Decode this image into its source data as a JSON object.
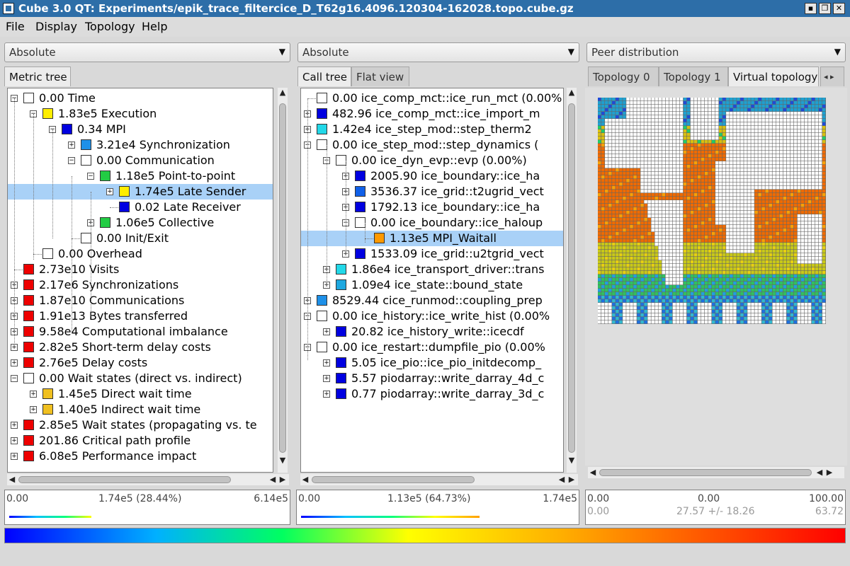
{
  "window": {
    "title": "Cube 3.0 QT: Experiments/epik_trace_filtercice_D_T62g16.4096.120304-162028.topo.cube.gz"
  },
  "menu": [
    "File",
    "Display",
    "Topology",
    "Help"
  ],
  "panels": {
    "metric": {
      "mode": "Absolute",
      "tabs": [
        "Metric tree"
      ]
    },
    "call": {
      "mode": "Absolute",
      "tabs": [
        "Call tree",
        "Flat view"
      ]
    },
    "system": {
      "mode": "Peer distribution",
      "tabs": [
        "Topology 0",
        "Topology 1",
        "Virtual topology"
      ]
    }
  },
  "metric_tree": [
    {
      "text": "0.00 Time",
      "color": "#ffffff",
      "depth": 0,
      "exp": "-"
    },
    {
      "text": "1.83e5 Execution",
      "color": "#ffee00",
      "depth": 1,
      "exp": "-"
    },
    {
      "text": "0.34 MPI",
      "color": "#0000e0",
      "depth": 2,
      "exp": "-"
    },
    {
      "text": "3.21e4 Synchronization",
      "color": "#1e90e8",
      "depth": 3,
      "exp": "+"
    },
    {
      "text": "0.00 Communication",
      "color": "#ffffff",
      "depth": 3,
      "exp": "-"
    },
    {
      "text": "1.18e5 Point-to-point",
      "color": "#22cc44",
      "depth": 4,
      "exp": "-"
    },
    {
      "text": "1.74e5 Late Sender",
      "color": "#ffee00",
      "depth": 5,
      "exp": "+",
      "selected": true
    },
    {
      "text": "0.02 Late Receiver",
      "color": "#0000e0",
      "depth": 5,
      "exp": ""
    },
    {
      "text": "1.06e5 Collective",
      "color": "#22cc44",
      "depth": 4,
      "exp": "+"
    },
    {
      "text": "0.00 Init/Exit",
      "color": "#ffffff",
      "depth": 3,
      "exp": ""
    },
    {
      "text": "0.00 Overhead",
      "color": "#ffffff",
      "depth": 1,
      "exp": ""
    },
    {
      "text": "2.73e10 Visits",
      "color": "#ee0000",
      "depth": 0,
      "exp": ""
    },
    {
      "text": "2.17e6 Synchronizations",
      "color": "#ee0000",
      "depth": 0,
      "exp": "+"
    },
    {
      "text": "1.87e10 Communications",
      "color": "#ee0000",
      "depth": 0,
      "exp": "+"
    },
    {
      "text": "1.91e13 Bytes transferred",
      "color": "#ee0000",
      "depth": 0,
      "exp": "+"
    },
    {
      "text": "9.58e4 Computational imbalance",
      "color": "#ee0000",
      "depth": 0,
      "exp": "+"
    },
    {
      "text": "2.82e5 Short-term delay costs",
      "color": "#ee0000",
      "depth": 0,
      "exp": "+"
    },
    {
      "text": "2.76e5 Delay costs",
      "color": "#ee0000",
      "depth": 0,
      "exp": "+"
    },
    {
      "text": "0.00 Wait states (direct vs. indirect)",
      "color": "#ffffff",
      "depth": 0,
      "exp": "-"
    },
    {
      "text": "1.45e5 Direct wait time",
      "color": "#f0c020",
      "depth": 1,
      "exp": "+"
    },
    {
      "text": "1.40e5 Indirect wait time",
      "color": "#f0c020",
      "depth": 1,
      "exp": "+"
    },
    {
      "text": "2.85e5 Wait states (propagating vs. te",
      "color": "#ee0000",
      "depth": 0,
      "exp": "+"
    },
    {
      "text": "201.86 Critical path profile",
      "color": "#ee0000",
      "depth": 0,
      "exp": "+"
    },
    {
      "text": "6.08e5 Performance impact",
      "color": "#ee0000",
      "depth": 0,
      "exp": "+"
    }
  ],
  "call_tree": [
    {
      "text": "0.00 ice_comp_mct::ice_run_mct (0.00%",
      "color": "#ffffff",
      "depth": 0,
      "exp": ""
    },
    {
      "text": "482.96 ice_comp_mct::ice_import_m",
      "color": "#0000e0",
      "depth": 0,
      "exp": "+"
    },
    {
      "text": "1.42e4 ice_step_mod::step_therm2",
      "color": "#22d8e8",
      "depth": 0,
      "exp": "+"
    },
    {
      "text": "0.00 ice_step_mod::step_dynamics (",
      "color": "#ffffff",
      "depth": 0,
      "exp": "-"
    },
    {
      "text": "0.00 ice_dyn_evp::evp (0.00%)",
      "color": "#ffffff",
      "depth": 1,
      "exp": "-"
    },
    {
      "text": "2005.90 ice_boundary::ice_ha",
      "color": "#0000e0",
      "depth": 2,
      "exp": "+"
    },
    {
      "text": "3536.37 ice_grid::t2ugrid_vect",
      "color": "#1060e8",
      "depth": 2,
      "exp": "+"
    },
    {
      "text": "1792.13 ice_boundary::ice_ha",
      "color": "#0000e0",
      "depth": 2,
      "exp": "+"
    },
    {
      "text": "0.00 ice_boundary::ice_haloup",
      "color": "#ffffff",
      "depth": 2,
      "exp": "-"
    },
    {
      "text": "1.13e5 MPI_Waitall",
      "color": "#ff9900",
      "depth": 3,
      "exp": "",
      "selected": true
    },
    {
      "text": "1533.09 ice_grid::u2tgrid_vect",
      "color": "#0000e0",
      "depth": 2,
      "exp": "+"
    },
    {
      "text": "1.86e4 ice_transport_driver::trans",
      "color": "#22d8e8",
      "depth": 1,
      "exp": "+"
    },
    {
      "text": "1.09e4 ice_state::bound_state",
      "color": "#1ea8e0",
      "depth": 1,
      "exp": "+"
    },
    {
      "text": "8529.44 cice_runmod::coupling_prep",
      "color": "#1e90e8",
      "depth": 0,
      "exp": "+"
    },
    {
      "text": "0.00 ice_history::ice_write_hist (0.00%",
      "color": "#ffffff",
      "depth": 0,
      "exp": "-"
    },
    {
      "text": "20.82 ice_history_write::icecdf",
      "color": "#0000e0",
      "depth": 1,
      "exp": "+"
    },
    {
      "text": "0.00 ice_restart::dumpfile_pio (0.00%",
      "color": "#ffffff",
      "depth": 0,
      "exp": "-"
    },
    {
      "text": "5.05 ice_pio::ice_pio_initdecomp_",
      "color": "#0000e0",
      "depth": 1,
      "exp": "+"
    },
    {
      "text": "5.57 piodarray::write_darray_4d_c",
      "color": "#0000e0",
      "depth": 1,
      "exp": "+"
    },
    {
      "text": "0.77 piodarray::write_darray_3d_c",
      "color": "#0000e0",
      "depth": 1,
      "exp": "+"
    }
  ],
  "info": {
    "metric": {
      "min": "0.00",
      "mid": "1.74e5 (28.44%)",
      "max": "6.14e5"
    },
    "call": {
      "min": "0.00",
      "mid": "1.13e5 (64.73%)",
      "max": "1.74e5"
    },
    "system": {
      "min": "0.00",
      "mid": "0.00",
      "max": "100.00",
      "min2": "0.00",
      "mid2": "27.57 +/- 18.26",
      "max2": "63.72"
    }
  },
  "colors": {
    "selection": "#a9d1f7",
    "titlebar": "#2d6ea8"
  },
  "icons": [
    "minimize-icon",
    "restore-icon",
    "close-icon",
    "chevron-down-icon",
    "scroll-up-icon",
    "scroll-down-icon",
    "scroll-left-icon",
    "scroll-right-icon"
  ]
}
